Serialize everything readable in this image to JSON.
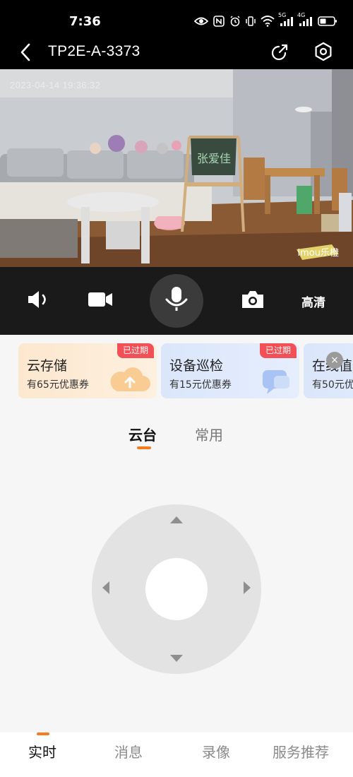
{
  "status_bar": {
    "time": "7:36",
    "network_5g": "5G",
    "network_4g": "4G"
  },
  "header": {
    "device_name": "TP2E-A-3373",
    "back_icon": "chevron-left-icon",
    "share_icon": "share-arrow-icon",
    "settings_icon": "hexagon-gear-icon"
  },
  "video": {
    "timestamp": "2023-04-14 19:36:32",
    "watermark": "imou乐橙",
    "board_text": "张爱佳"
  },
  "controls": {
    "sound_icon": "speaker-icon",
    "record_icon": "video-camera-icon",
    "mic_icon": "microphone-icon",
    "snapshot_icon": "camera-icon",
    "quality_label": "高清"
  },
  "promos": [
    {
      "title": "云存储",
      "subtitle": "有65元优惠券",
      "badge": "已过期",
      "color": "#fde7cf",
      "art_icon": "cloud-icon"
    },
    {
      "title": "设备巡检",
      "subtitle": "有15元优惠券",
      "badge": "已过期",
      "color": "#dbe6fb",
      "art_icon": "chat-bubble-icon"
    },
    {
      "title": "在线值",
      "subtitle": "有50元优"
    }
  ],
  "promo_close_symbol": "×",
  "tabs": [
    {
      "label": "云台",
      "active": true
    },
    {
      "label": "常用",
      "active": false
    }
  ],
  "ptz": {
    "up_icon": "triangle-up-icon",
    "down_icon": "triangle-down-icon",
    "left_icon": "triangle-left-icon",
    "right_icon": "triangle-right-icon"
  },
  "bottom_nav": [
    {
      "label": "实时",
      "active": true
    },
    {
      "label": "消息",
      "active": false
    },
    {
      "label": "录像",
      "active": false
    },
    {
      "label": "服务推荐",
      "active": false
    }
  ],
  "colors": {
    "accent": "#f57c1f",
    "badge": "#f25056",
    "dark_bg": "#000000",
    "control_bg": "#1a1a1a"
  }
}
